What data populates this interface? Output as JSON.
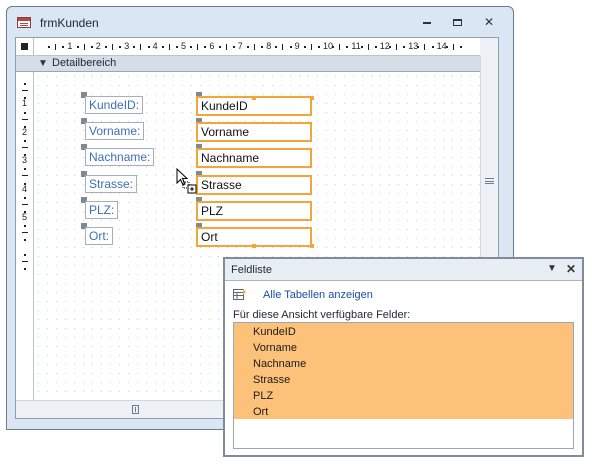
{
  "window": {
    "title": "frmKunden",
    "minimize_icon": "minimize-icon",
    "maximize_icon": "maximize-icon",
    "close_icon": "close-icon"
  },
  "ruler": {
    "horizontal_numbers": [
      "1",
      "2",
      "3",
      "4",
      "5",
      "6",
      "7",
      "8",
      "9",
      "10",
      "11",
      "12",
      "13",
      "14"
    ],
    "vertical_numbers": [
      "1",
      "2",
      "3",
      "4",
      "5"
    ]
  },
  "section": {
    "label": "Detailbereich"
  },
  "form": {
    "labels": [
      "KundeID:",
      "Vorname:",
      "Nachname:",
      "Strasse:",
      "PLZ:",
      "Ort:"
    ],
    "fields": [
      "KundeID",
      "Vorname",
      "Nachname",
      "Strasse",
      "PLZ",
      "Ort"
    ]
  },
  "feldliste": {
    "title": "Feldliste",
    "show_all_link": "Alle Tabellen anzeigen",
    "available_label": "Für diese Ansicht verfügbare Felder:",
    "fields": [
      "KundeID",
      "Vorname",
      "Nachname",
      "Strasse",
      "PLZ",
      "Ort"
    ],
    "selected_color": "#fdc27a"
  },
  "colors": {
    "selection_border": "#f3a53a",
    "label_text": "#3d6fb3"
  }
}
